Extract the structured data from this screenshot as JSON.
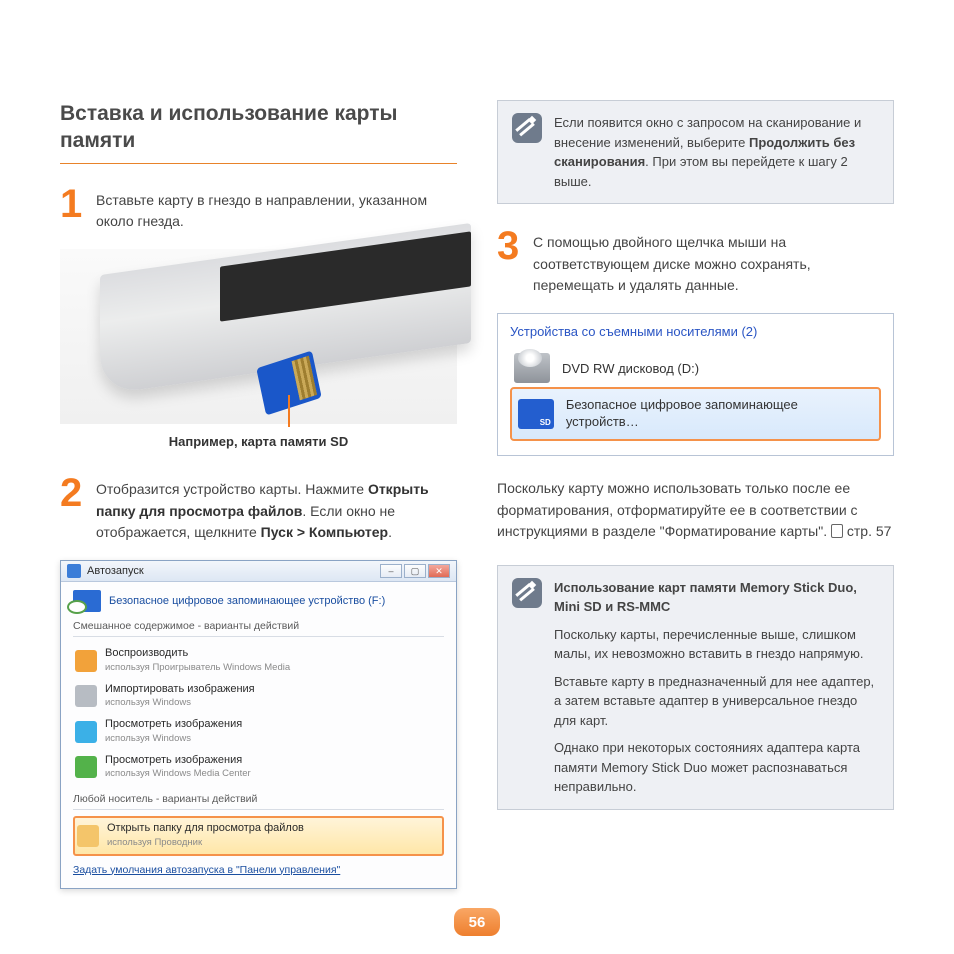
{
  "page": {
    "title": "Вставка и использование карты памяти",
    "number": "56"
  },
  "step1": {
    "text": "Вставьте карту в гнездо в направлении, указанном около гнезда.",
    "caption": "Например, карта памяти SD"
  },
  "step2": {
    "lead": "Отобразится устройство карты. Нажмите ",
    "bold1": "Открыть папку для просмотра файлов",
    "tail1": ". Если окно не отображается, щелкните ",
    "bold2": "Пуск > Компьютер",
    "tail2": "."
  },
  "autoplay": {
    "title": "Автозапуск",
    "device": "Безопасное цифровое запоминающее устройство (F:)",
    "section1": "Смешанное содержимое - варианты действий",
    "items": [
      {
        "label": "Воспроизводить",
        "sub": "используя Проигрыватель Windows Media",
        "color": "#f2a23a"
      },
      {
        "label": "Импортировать изображения",
        "sub": "используя Windows",
        "color": "#b7bcc3"
      },
      {
        "label": "Просмотреть изображения",
        "sub": "используя Windows",
        "color": "#3bb0e7"
      },
      {
        "label": "Просмотреть изображения",
        "sub": "используя Windows Media Center",
        "color": "#53b24a"
      }
    ],
    "section2": "Любой носитель - варианты действий",
    "highlight": {
      "label": "Открыть папку для просмотра файлов",
      "sub": "используя Проводник",
      "color": "#f4c56a"
    },
    "link": "Задать умолчания автозапуска в \"Панели управления\""
  },
  "note_top": {
    "pre": "Если появится окно с запросом на сканирование и внесение изменений, выберите ",
    "bold": "Продолжить без сканирования",
    "post": ". При этом вы перейдете к шагу 2 выше."
  },
  "step3": {
    "text": "С помощью двойного щелчка мыши на соответствующем диске можно сохранять, перемещать и удалять данные."
  },
  "devices": {
    "header": "Устройства со съемными носителями (2)",
    "dvd": "DVD RW дисковод (D:)",
    "sd": "Безопасное цифровое запоминающее устройств…"
  },
  "para": {
    "text": "Поскольку карту можно использовать только после ее форматирования, отформатируйте ее в соответствии с инструкциями в разделе \"Форматирование карты\". ",
    "ref": "стр. 57"
  },
  "note_bottom": {
    "title": "Использование карт памяти Memory Stick Duo, Mini SD и RS-MMC",
    "p1": "Поскольку карты, перечисленные выше, слишком малы, их невозможно вставить в гнездо напрямую.",
    "p2": "Вставьте карту в предназначенный для нее адаптер, а затем вставьте адаптер в универсальное гнездо для карт.",
    "p3": "Однако при некоторых состояниях адаптера карта памяти Memory Stick Duo может распознаваться неправильно."
  }
}
